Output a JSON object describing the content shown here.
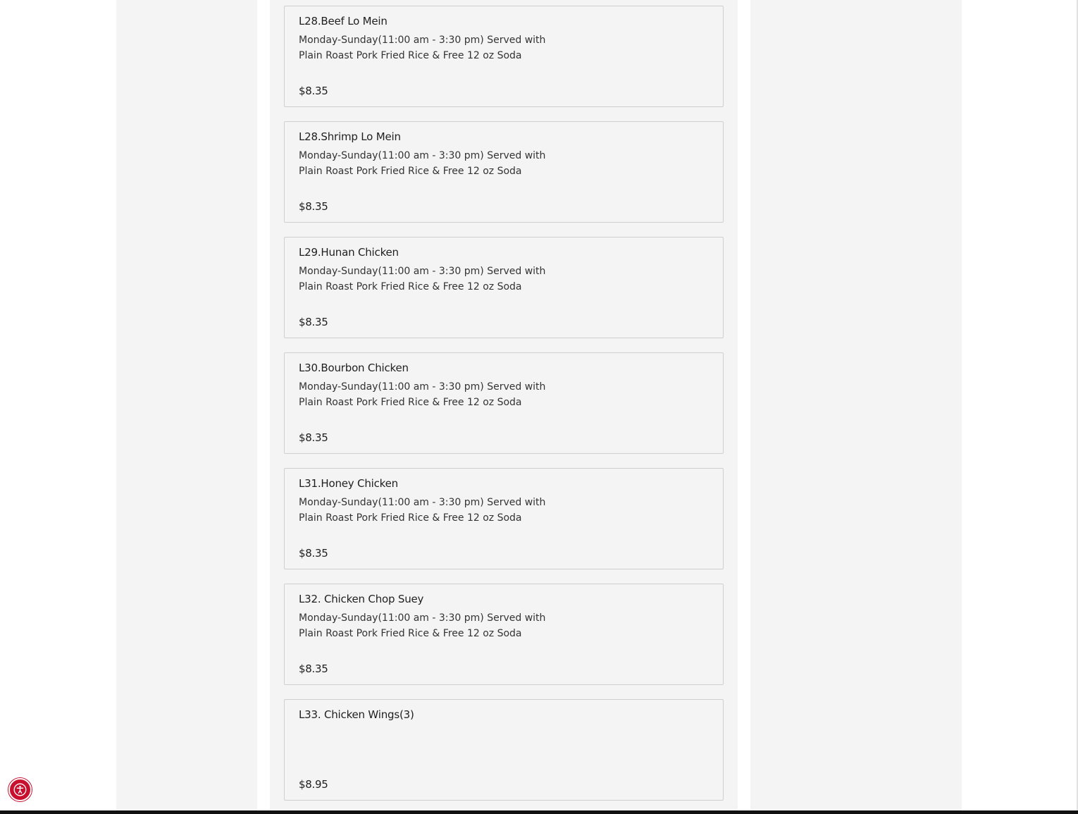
{
  "menu": {
    "items": [
      {
        "name": "L28.Beef Lo Mein",
        "description": "Monday-Sunday(11:00 am - 3:30 pm) Served with Plain Roast Pork Fried Rice & Free 12 oz Soda",
        "price": "$8.35"
      },
      {
        "name": "L28.Shrimp Lo Mein",
        "description": "Monday-Sunday(11:00 am - 3:30 pm) Served with Plain Roast Pork Fried Rice & Free 12 oz Soda",
        "price": "$8.35"
      },
      {
        "name": "L29.Hunan Chicken",
        "description": "Monday-Sunday(11:00 am - 3:30 pm) Served with Plain Roast Pork Fried Rice & Free 12 oz Soda",
        "price": "$8.35"
      },
      {
        "name": "L30.Bourbon Chicken",
        "description": "Monday-Sunday(11:00 am - 3:30 pm) Served with Plain Roast Pork Fried Rice & Free 12 oz Soda",
        "price": "$8.35"
      },
      {
        "name": "L31.Honey Chicken",
        "description": "Monday-Sunday(11:00 am - 3:30 pm) Served with Plain Roast Pork Fried Rice & Free 12 oz Soda",
        "price": "$8.35"
      },
      {
        "name": "L32. Chicken Chop Suey",
        "description": "Monday-Sunday(11:00 am - 3:30 pm) Served with Plain Roast Pork Fried Rice & Free 12 oz Soda",
        "price": "$8.35"
      },
      {
        "name": "L33. Chicken Wings(3)",
        "description": "",
        "price": "$8.95"
      }
    ]
  },
  "accessibility_widget": {
    "icon": "accessibility-icon",
    "color": "#c8102e"
  }
}
